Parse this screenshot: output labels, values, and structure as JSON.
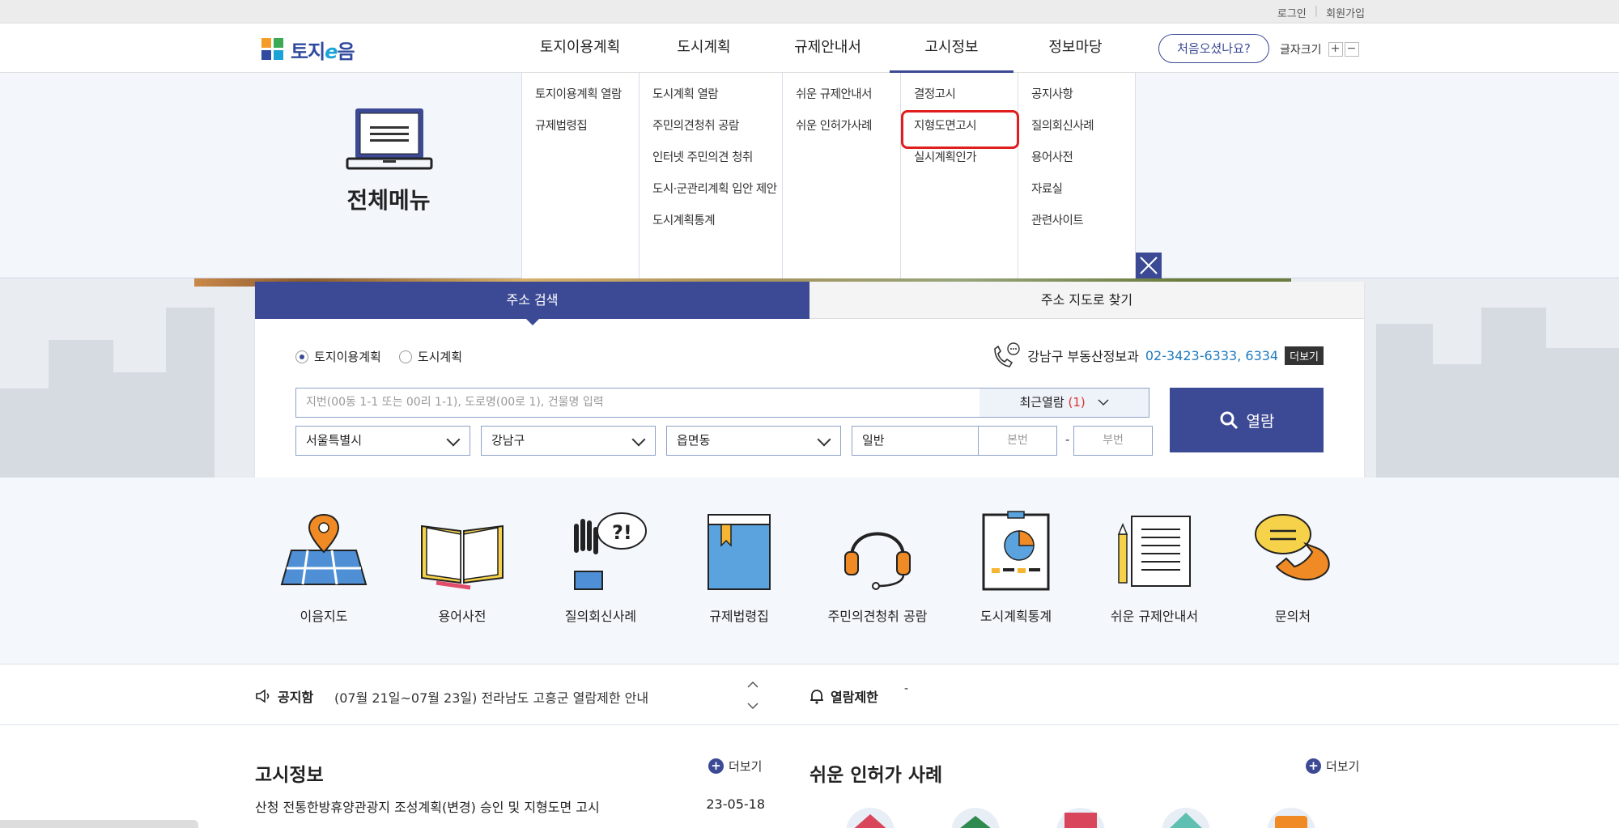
{
  "topbar": {
    "login": "로그인",
    "signup": "회원가입"
  },
  "logo": {
    "text_a": "토지",
    "text_b": "e",
    "text_c": "음"
  },
  "gnb": [
    "토지이용계획",
    "도시계획",
    "규제안내서",
    "고시정보",
    "정보마당"
  ],
  "gnb_active_index": 3,
  "first_visit": "처음오셨나요?",
  "fontsize": {
    "label": "글자크기",
    "plus": "+",
    "minus": "−"
  },
  "mega": {
    "title": "전체메뉴",
    "columns": [
      [
        "토지이용계획 열람",
        "규제법령집"
      ],
      [
        "도시계획 열람",
        "주민의견청취 공람",
        "인터넷 주민의견 청취",
        "도시·군관리계획 입안 제안",
        "도시계획통계"
      ],
      [
        "쉬운 규제안내서",
        "쉬운 인허가사례"
      ],
      [
        "결정고시",
        "지형도면고시",
        "실시계획인가"
      ],
      [
        "공지사항",
        "질의회신사례",
        "용어사전",
        "자료실",
        "관련사이트"
      ]
    ]
  },
  "search": {
    "tab_address": "주소 검색",
    "tab_map": "주소 지도로 찾기",
    "radio_land": "토지이용계획",
    "radio_city": "도시계획",
    "contact_prefix": "강남구 부동산정보과",
    "contact_tel": "02-3423-6333, 6334",
    "contact_more": "더보기",
    "address_placeholder": "지번(00동 1-1 또는 00리 1-1), 도로명(00로 1), 건물명 입력",
    "recent_label": "최근열람",
    "recent_count": "(1)",
    "sido": "서울특별시",
    "sigungu": "강남구",
    "eupmyeondong": "읍면동",
    "type": "일반",
    "main_no": "본번",
    "sub_no": "부번",
    "dash": "-",
    "submit": "열람"
  },
  "quick": [
    "이음지도",
    "용어사전",
    "질의회신사례",
    "규제법령집",
    "주민의견청취 공람",
    "도시계획통계",
    "쉬운 규제안내서",
    "문의처"
  ],
  "notice": {
    "label": "공지함",
    "text": "(07월 21일~07월 23일) 전라남도 고흥군 열람제한 안내",
    "limit_label": "열람제한",
    "limit_tick": "-"
  },
  "bottom": {
    "left_title": "고시정보",
    "left_more": "더보기",
    "right_title": "쉬운 인허가 사례",
    "right_more": "더보기",
    "news_title": "산청 전통한방휴양관광지 조성계획(변경) 승인 및 지형도면 고시",
    "news_date": "23-05-18"
  },
  "colors": {
    "primary": "#3c4a95",
    "highlight": "#e01e1e",
    "link": "#1f7ac0"
  }
}
